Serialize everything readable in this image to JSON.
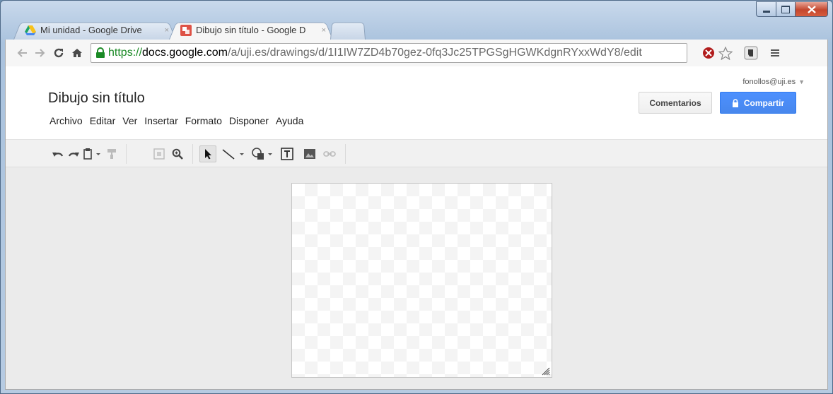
{
  "browser": {
    "tabs": [
      {
        "title": "Mi unidad - Google Drive",
        "close": "×",
        "icon": "google-drive-icon",
        "active": false
      },
      {
        "title": "Dibujo sin título - Google D",
        "close": "×",
        "icon": "google-drawings-icon",
        "active": true
      }
    ],
    "address": {
      "scheme": "https://",
      "host": "docs.google.com",
      "path": "/a/uji.es/drawings/d/1I1IW7ZD4b70gez-0fq3Jc25TPGSgHGWKdgnRYxxWdY8/edit"
    },
    "nav_icons": [
      "back-icon",
      "forward-icon",
      "reload-icon",
      "home-icon"
    ],
    "extension_icons": [
      "blocked-extension-icon",
      "bookmark-star-icon",
      "evernote-icon",
      "menu-icon"
    ]
  },
  "app": {
    "doc_title": "Dibujo sin título",
    "account": "fonollos@uji.es",
    "menu": [
      "Archivo",
      "Editar",
      "Ver",
      "Insertar",
      "Formato",
      "Disponer",
      "Ayuda"
    ],
    "comments_label": "Comentarios",
    "share_label": "Compartir",
    "toolbar": [
      "undo-icon",
      "redo-icon",
      "paste-icon",
      "paint-format-icon",
      "fit-icon",
      "zoom-icon",
      "select-icon",
      "line-icon",
      "shape-icon",
      "textbox-icon",
      "image-icon",
      "link-icon"
    ],
    "colors": {
      "share_blue": "#4d90fe",
      "canvas_border": "#c4c4c4",
      "url_green": "#1a8a25"
    }
  }
}
